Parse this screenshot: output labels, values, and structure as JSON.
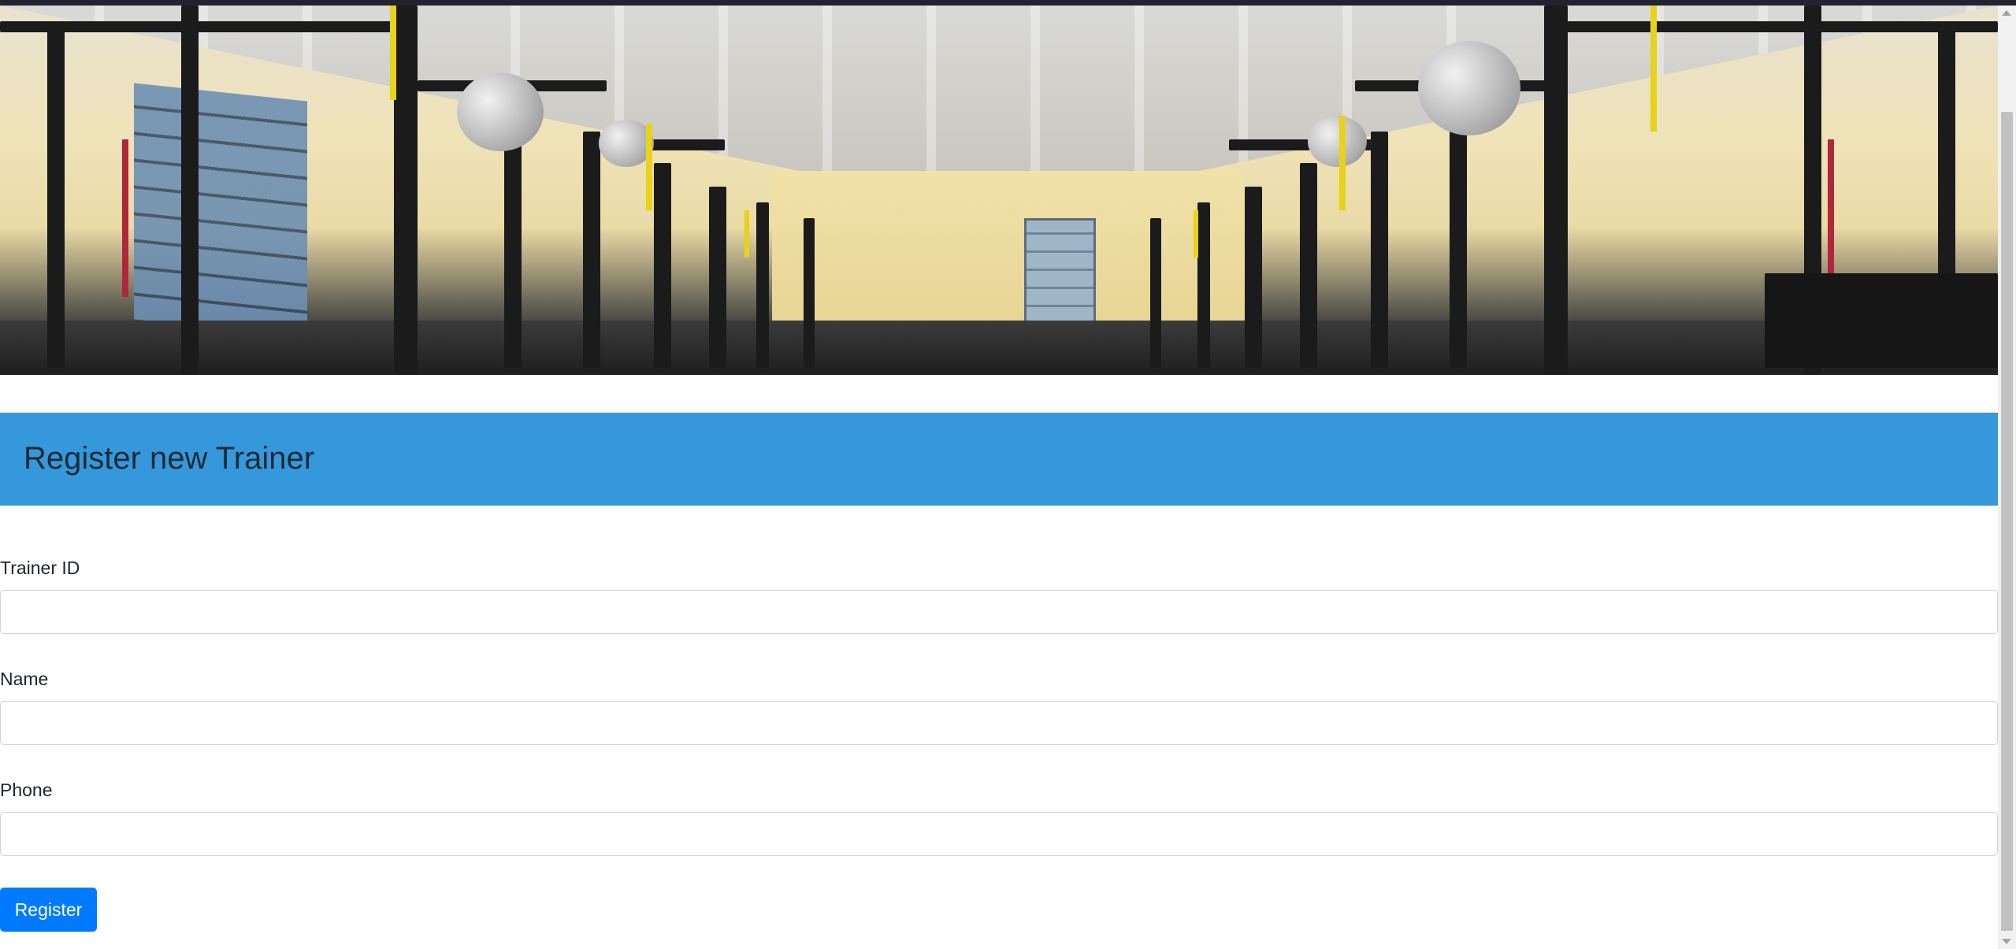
{
  "header": {
    "title": "Register new Trainer"
  },
  "form": {
    "trainer_id": {
      "label": "Trainer ID",
      "value": "",
      "placeholder": ""
    },
    "name": {
      "label": "Name",
      "value": "",
      "placeholder": ""
    },
    "phone": {
      "label": "Phone",
      "value": "",
      "placeholder": ""
    },
    "submit_label": "Register"
  },
  "hero": {
    "icon": "gym-photo"
  },
  "colors": {
    "header_bg": "#3498db",
    "button_bg": "#007bff",
    "button_text": "#ffffff",
    "top_bar": "#23232f"
  }
}
